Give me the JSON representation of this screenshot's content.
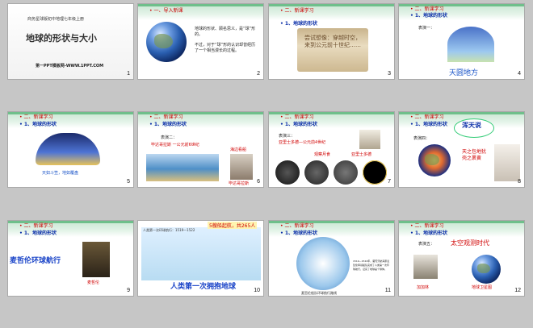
{
  "slides": [
    {
      "num": "1",
      "publisher": "商务星球版初中地理七年级上册",
      "title": "地球的形状与大小",
      "footer": "第一PPT模板网-WWW.1PPT.COM"
    },
    {
      "num": "2",
      "section": "一、导入新课",
      "text1": "地球的形状、顾名思义，是“球”形的。",
      "text2": "不过，对于“球”形的认识却曾经历了一个相当漫长的过程。"
    },
    {
      "num": "3",
      "section": "二、新课学习",
      "subtitle": "1、地球的形状",
      "scroll_text": "尝试想像：穿越时空，来到公元前十世纪……"
    },
    {
      "num": "4",
      "section": "二、新课学习",
      "subtitle": "1、地球的形状",
      "label": "表演一：",
      "caption": "天圆地方"
    },
    {
      "num": "5",
      "section": "二、新课学习",
      "subtitle": "1、地球的形状",
      "caption": "天如斗笠，地如覆盘"
    },
    {
      "num": "6",
      "section": "二、新课学习",
      "subtitle": "1、地球的形状",
      "label": "表演二：",
      "line": "毕达哥拉斯 一公元前6世纪",
      "side_top": "海边看船",
      "side_bottom": "毕达哥拉斯"
    },
    {
      "num": "7",
      "section": "二、新课学习",
      "subtitle": "1、地球的形状",
      "label": "表演三：",
      "line": "亚里士多德—公元前4世纪",
      "obs": "观察月食",
      "person": "亚里士多德"
    },
    {
      "num": "8",
      "section": "二、新课学习",
      "subtitle": "1、地球的形状",
      "label": "表演四：",
      "cloud": "浑天说",
      "quote": "天之包地犹壳之裹黄"
    },
    {
      "num": "9",
      "section": "二、新课学习",
      "subtitle": "1、地球的形状",
      "title": "麦哲伦环球航行",
      "person": "麦哲伦"
    },
    {
      "num": "10",
      "head": "人类第一次环球航行：1519—1522",
      "banner": "5艘船起航，共265人",
      "caption": "人类第一次拥抱地球"
    },
    {
      "num": "11",
      "section": "二、新课学习",
      "subtitle": "1、地球的形状",
      "note": "1519—1522年，葡萄牙航海家麦哲伦率领船队完成了人类第一次环球航行，证实了地球是个球体。",
      "map_caption": "麦哲伦船队环球航行路线"
    },
    {
      "num": "12",
      "section": "二、新课学习",
      "subtitle": "1、地球的形状",
      "label": "表演五：",
      "title": "太空观测时代",
      "person": "加加林",
      "earth_caption": "地球卫星图"
    }
  ],
  "colors": {
    "accent_green": "#6fbf8b",
    "title_red": "#c00",
    "subtitle_blue": "#0a2ea8"
  }
}
